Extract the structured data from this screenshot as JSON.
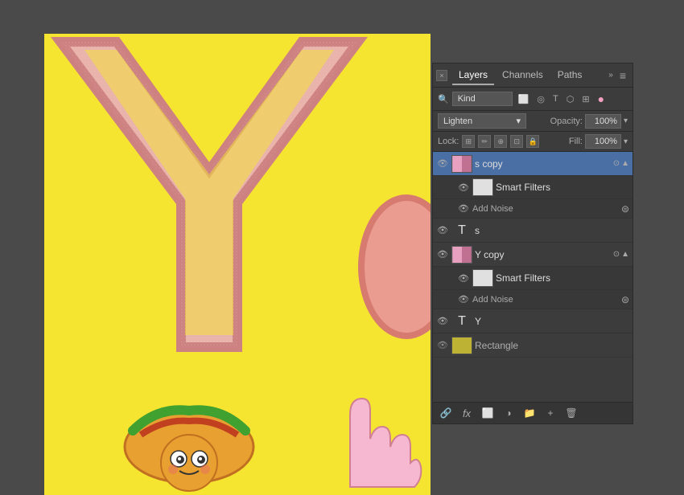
{
  "panel": {
    "close_label": "×",
    "double_arrow": "»",
    "tabs": [
      {
        "id": "layers",
        "label": "Layers",
        "active": true
      },
      {
        "id": "channels",
        "label": "Channels",
        "active": false
      },
      {
        "id": "paths",
        "label": "Paths",
        "active": false
      }
    ],
    "menu_icon": "≡",
    "filter": {
      "label": "Kind",
      "icons": [
        "⬜",
        "◎",
        "T",
        "⬡",
        "🔒",
        "●"
      ]
    },
    "blend_mode": "Lighten",
    "opacity_label": "Opacity:",
    "opacity_value": "100%",
    "lock_label": "Lock:",
    "lock_icons": [
      "⊞",
      "✏",
      "⊕",
      "⊡",
      "🔒"
    ],
    "fill_label": "Fill:",
    "fill_value": "100%",
    "layers": [
      {
        "id": "s-copy",
        "name": "s copy",
        "visible": true,
        "type": "smart",
        "selected": true,
        "has_smart_filter": true,
        "expanded": true,
        "sub_layers": [
          {
            "id": "sf-s",
            "name": "Smart Filters",
            "type": "filter-mask"
          },
          {
            "id": "noise-s",
            "name": "Add Noise",
            "type": "filter"
          }
        ]
      },
      {
        "id": "s",
        "name": "s",
        "visible": true,
        "type": "text"
      },
      {
        "id": "y-copy",
        "name": "Y copy",
        "visible": true,
        "type": "smart",
        "has_smart_filter": true,
        "expanded": true,
        "sub_layers": [
          {
            "id": "sf-y",
            "name": "Smart Filters",
            "type": "filter-mask"
          },
          {
            "id": "noise-y",
            "name": "Add Noise",
            "type": "filter"
          }
        ]
      },
      {
        "id": "y",
        "name": "Y",
        "visible": true,
        "type": "text"
      },
      {
        "id": "rectangle",
        "name": "Rectangle",
        "visible": true,
        "type": "shape"
      }
    ],
    "footer_icons": [
      "🔗",
      "fx",
      "⬜",
      "⬜",
      "⊕",
      "🗑"
    ]
  }
}
